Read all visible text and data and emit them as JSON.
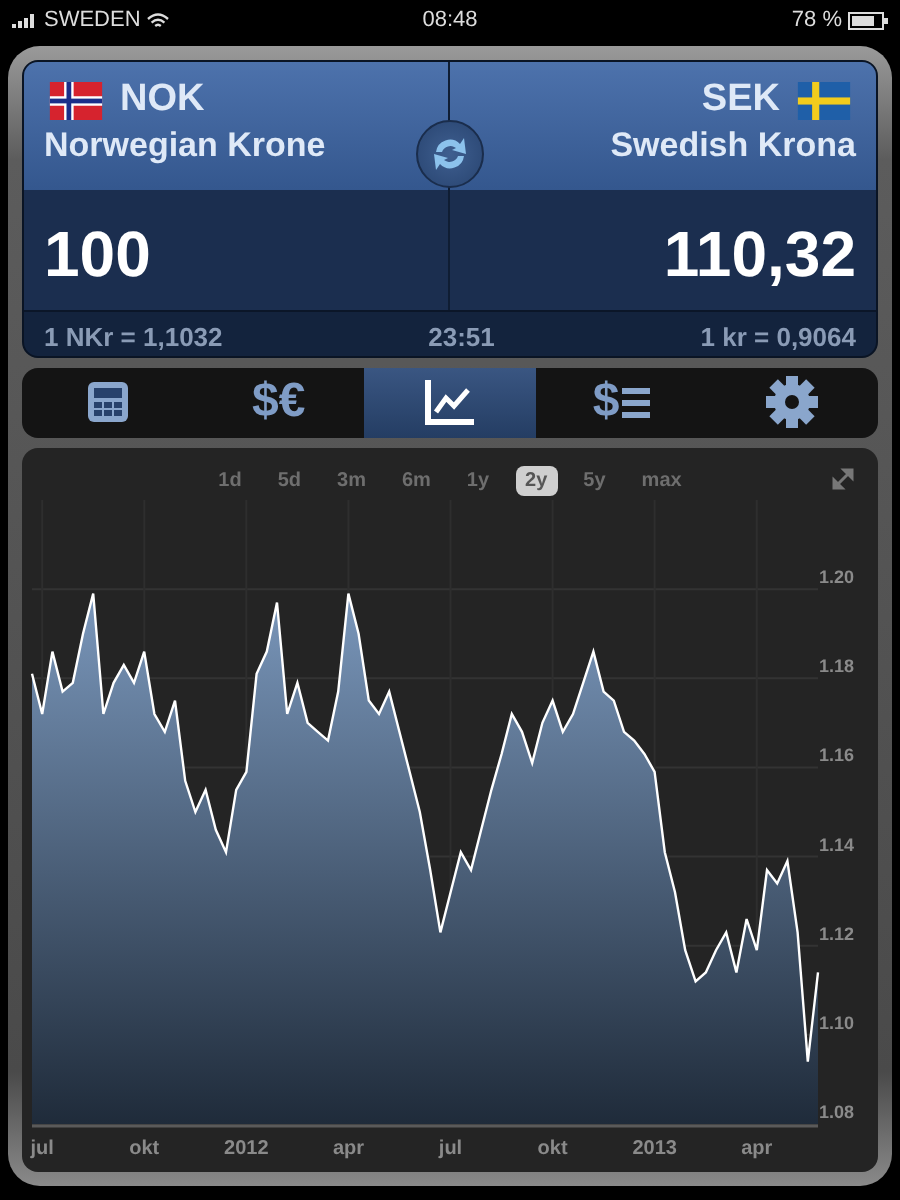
{
  "status_bar": {
    "carrier": "SWEDEN",
    "time": "08:48",
    "battery": "78 %"
  },
  "converter": {
    "from": {
      "code": "NOK",
      "name": "Norwegian Krone",
      "amount": "100",
      "rate": "1 NKr = 1,1032",
      "kind": "norway"
    },
    "to": {
      "code": "SEK",
      "name": "Swedish Krona",
      "amount": "110,32",
      "rate": "1 kr = 0,9064",
      "kind": "sweden"
    },
    "updated": "23:51"
  },
  "toolbar": [
    {
      "kind": "calculator",
      "selected": false
    },
    {
      "kind": "text",
      "label": "$€",
      "selected": false
    },
    {
      "kind": "chart",
      "selected": true
    },
    {
      "kind": "list",
      "label": "$",
      "selected": false
    },
    {
      "kind": "gear",
      "selected": false
    }
  ],
  "periods": [
    {
      "label": "1d",
      "selected": false
    },
    {
      "label": "5d",
      "selected": false
    },
    {
      "label": "3m",
      "selected": false
    },
    {
      "label": "6m",
      "selected": false
    },
    {
      "label": "1y",
      "selected": false
    },
    {
      "label": "2y",
      "selected": true
    },
    {
      "label": "5y",
      "selected": false
    },
    {
      "label": "max",
      "selected": false
    }
  ],
  "chart": {
    "chart_data": {
      "type": "area",
      "grid": true,
      "ylim": [
        1.08,
        1.22
      ],
      "categories": [
        null,
        "jul",
        null,
        null,
        null,
        null,
        null,
        null,
        null,
        null,
        null,
        "okt",
        null,
        null,
        null,
        null,
        null,
        null,
        null,
        null,
        null,
        "2012",
        null,
        null,
        null,
        null,
        null,
        null,
        null,
        null,
        null,
        "apr",
        null,
        null,
        null,
        null,
        null,
        null,
        null,
        null,
        null,
        "jul",
        null,
        null,
        null,
        null,
        null,
        null,
        null,
        null,
        null,
        "okt",
        null,
        null,
        null,
        null,
        null,
        null,
        null,
        null,
        null,
        "2013",
        null,
        null,
        null,
        null,
        null,
        null,
        null,
        null,
        null,
        "apr",
        null,
        null,
        null,
        null,
        null,
        null
      ],
      "values": [
        1.181,
        1.172,
        1.186,
        1.177,
        1.179,
        1.19,
        1.199,
        1.172,
        1.179,
        1.183,
        1.179,
        1.186,
        1.172,
        1.168,
        1.175,
        1.157,
        1.15,
        1.155,
        1.146,
        1.141,
        1.155,
        1.159,
        1.181,
        1.186,
        1.197,
        1.172,
        1.179,
        1.17,
        1.168,
        1.166,
        1.177,
        1.199,
        1.19,
        1.175,
        1.172,
        1.177,
        1.168,
        1.159,
        1.15,
        1.137,
        1.123,
        1.132,
        1.141,
        1.137,
        1.146,
        1.155,
        1.163,
        1.172,
        1.168,
        1.161,
        1.17,
        1.175,
        1.168,
        1.172,
        1.179,
        1.186,
        1.177,
        1.175,
        1.168,
        1.166,
        1.163,
        1.159,
        1.141,
        1.132,
        1.119,
        1.112,
        1.114,
        1.119,
        1.123,
        1.114,
        1.126,
        1.119,
        1.137,
        1.134,
        1.139,
        1.123,
        1.094,
        1.114
      ],
      "yticks": [
        {
          "value": 1.08,
          "label": "1.08"
        },
        {
          "value": 1.1,
          "label": "1.10"
        },
        {
          "value": 1.12,
          "label": "1.12"
        },
        {
          "value": 1.14,
          "label": "1.14"
        },
        {
          "value": 1.16,
          "label": "1.16"
        },
        {
          "value": 1.18,
          "label": "1.18"
        },
        {
          "value": 1.2,
          "label": "1.20"
        }
      ]
    }
  }
}
